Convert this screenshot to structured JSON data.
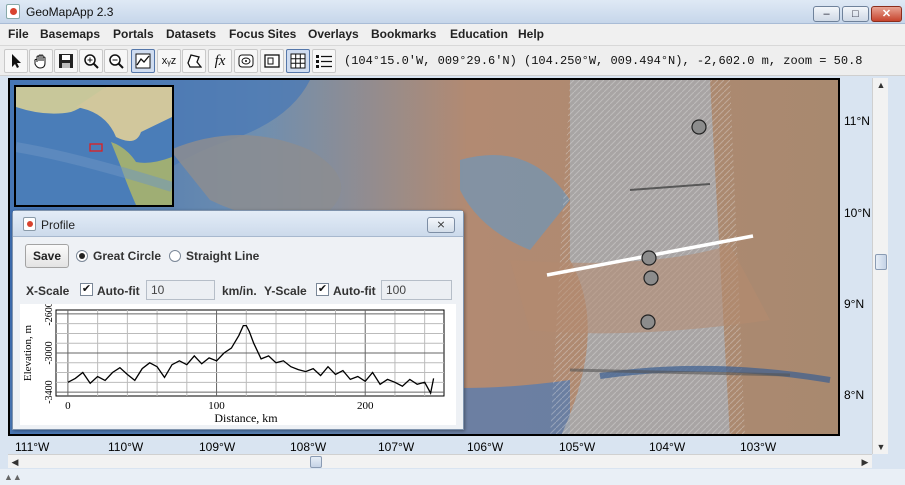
{
  "window": {
    "title": "GeoMapApp 2.3",
    "min": "–",
    "max": "□",
    "close": "✕"
  },
  "menu": [
    "File",
    "Basemaps",
    "Portals",
    "Datasets",
    "Focus Sites",
    "Overlays",
    "Bookmarks",
    "Education",
    "Help"
  ],
  "toolbar": {
    "tools": [
      "pointer-icon",
      "pan-hand-icon",
      "save-disk-icon",
      "zoom-in-icon",
      "zoom-out-icon",
      "profile-icon",
      "xyz-icon",
      "polygon-icon",
      "function-icon",
      "contour-icon",
      "frame-icon",
      "grid-icon",
      "layers-list-icon"
    ],
    "function_glyph": "fx",
    "xyz_glyph": "xᵧz",
    "coordinates": "(104°15.0′W, 009°29.6′N) (104.250°W, 009.494°N), -2,602.0 m, zoom = 50.8"
  },
  "map": {
    "lat_labels": [
      "11°N",
      "10°N",
      "9°N",
      "8°N"
    ],
    "lon_labels": [
      "111°W",
      "110°W",
      "109°W",
      "108°W",
      "107°W",
      "106°W",
      "105°W",
      "104°W",
      "103°W"
    ]
  },
  "profile": {
    "title": "Profile",
    "close": "⨯",
    "save_label": "Save",
    "mode_great_circle": "Great Circle",
    "mode_straight_line": "Straight Line",
    "x_scale_label": "X-Scale",
    "x_autofit_label": "Auto-fit",
    "x_value": "10",
    "x_unit": "km/in.",
    "y_scale_label": "Y-Scale",
    "y_autofit_label": "Auto-fit",
    "y_value": "100",
    "checkmark": "✔"
  },
  "chart_data": {
    "type": "line",
    "xlabel": "Distance, km",
    "ylabel": "Elevation, m",
    "x_ticks": [
      "0",
      "100",
      "200"
    ],
    "y_ticks": [
      "-2600",
      "-3000",
      "-3400"
    ],
    "xlim": [
      -8,
      253
    ],
    "ylim": [
      -3440,
      -2560
    ],
    "series": [
      {
        "x": [
          0,
          5,
          10,
          15,
          20,
          25,
          30,
          35,
          40,
          45,
          50,
          55,
          60,
          65,
          70,
          75,
          80,
          85,
          90,
          95,
          100,
          105,
          110,
          115,
          118,
          120,
          122,
          125,
          130,
          135,
          140,
          145,
          150,
          155,
          160,
          165,
          170,
          175,
          180,
          185,
          190,
          195,
          200,
          205,
          210,
          215,
          220,
          225,
          230,
          235,
          240,
          244,
          246
        ],
        "values": [
          -3300,
          -3260,
          -3200,
          -3310,
          -3240,
          -3280,
          -3200,
          -3150,
          -3220,
          -3280,
          -3160,
          -3100,
          -3140,
          -3250,
          -3120,
          -3080,
          -3120,
          -3030,
          -3110,
          -3050,
          -3080,
          -3000,
          -2950,
          -2820,
          -2720,
          -2720,
          -2780,
          -2900,
          -3060,
          -3030,
          -3100,
          -3080,
          -3140,
          -3170,
          -3190,
          -3160,
          -3230,
          -3140,
          -3220,
          -3180,
          -3270,
          -3240,
          -3290,
          -3200,
          -3320,
          -3270,
          -3300,
          -3340,
          -3270,
          -3320,
          -3300,
          -3410,
          -3260
        ]
      }
    ]
  }
}
